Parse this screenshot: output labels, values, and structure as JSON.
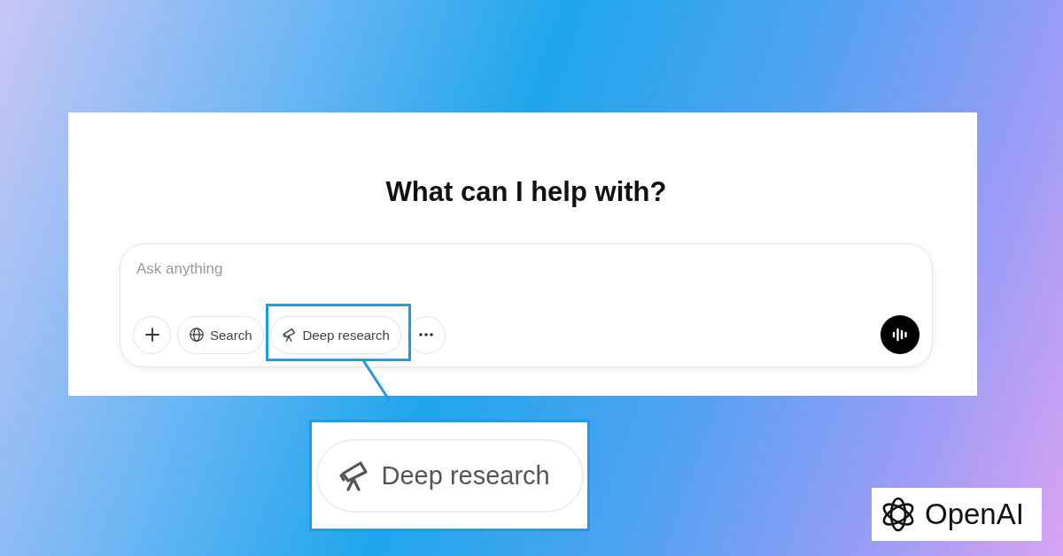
{
  "heading": "What can I help with?",
  "composer": {
    "placeholder": "Ask anything",
    "tools": [
      {
        "kind": "add"
      },
      {
        "kind": "search",
        "label": "Search"
      },
      {
        "kind": "deep_research",
        "label": "Deep research"
      },
      {
        "kind": "more"
      }
    ]
  },
  "callout": {
    "label": "Deep research"
  },
  "logo": {
    "text": "OpenAI"
  }
}
